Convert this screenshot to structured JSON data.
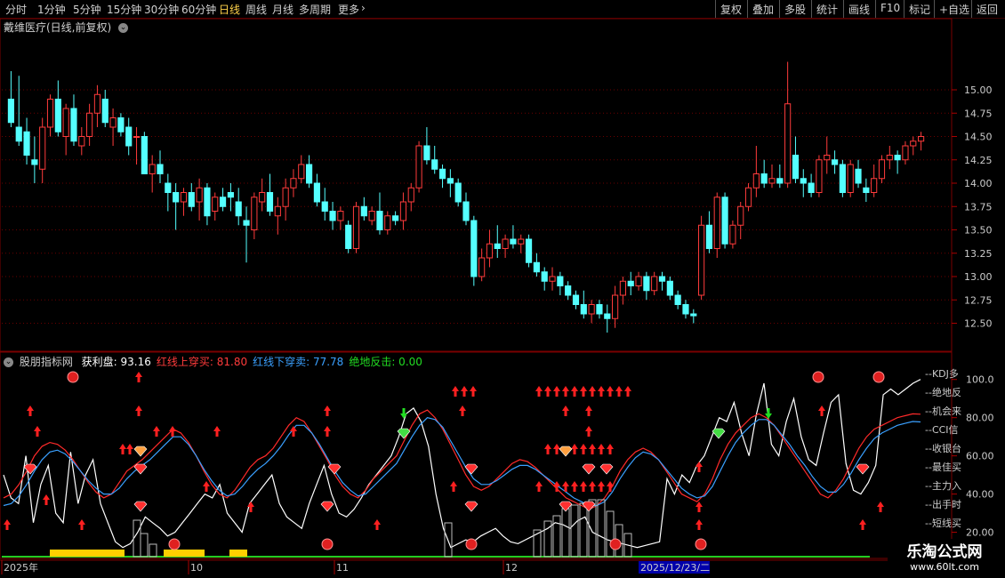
{
  "toolbar": {
    "periods": [
      "分时",
      "1分钟",
      "5分钟",
      "15分钟",
      "30分钟",
      "60分钟",
      "日线",
      "周线",
      "月线",
      "多周期",
      "更多"
    ],
    "active_period": "日线",
    "more_icon": "chevron-right-icon",
    "right_buttons": [
      "复权",
      "叠加",
      "多股",
      "统计",
      "画线",
      "F10",
      "标记",
      "+自选",
      "返回"
    ]
  },
  "main_chart": {
    "title": "戴维医疗(日线,前复权)",
    "dropdown_icon": "chevron-down-icon",
    "price_ticks": [
      "15.00",
      "14.75",
      "14.50",
      "14.25",
      "14.00",
      "13.75",
      "13.50",
      "13.25",
      "13.00",
      "12.75",
      "12.50"
    ],
    "up_color": "#ff3b3b",
    "down_color": "#54ffff"
  },
  "indicator": {
    "name": "股朋指标网",
    "items": [
      {
        "label": "获利盘: 93.16",
        "color": "#ffffff"
      },
      {
        "label": "红线上穿买: 81.80",
        "color": "#ff3b3b"
      },
      {
        "label": "红线下穿卖: 77.78",
        "color": "#3aa0ff"
      },
      {
        "label": "绝地反击: 0.00",
        "color": "#22dd22"
      }
    ],
    "ticks": [
      "100.0",
      "80.00",
      "60.00",
      "40.00",
      "20.00"
    ],
    "legend": [
      "KDJ多",
      "绝地反",
      "机会来",
      "CCI信",
      "收银台",
      "最佳买",
      "主力入",
      "出手时",
      "短线买"
    ]
  },
  "x_axis": {
    "labels": [
      "2025年",
      "10",
      "11",
      "12"
    ],
    "cursor_date": "2025/12/23/二"
  },
  "watermark": {
    "name": "乐淘公式网",
    "url": "www.60lt.com"
  },
  "chart_data": {
    "type": "candlestick",
    "ylim": [
      12.2,
      15.6
    ],
    "candles": [
      [
        14.9,
        15.2,
        14.6,
        14.65
      ],
      [
        14.6,
        15.15,
        14.4,
        14.45
      ],
      [
        14.55,
        14.7,
        14.2,
        14.3
      ],
      [
        14.25,
        14.5,
        14.0,
        14.2
      ],
      [
        14.15,
        14.7,
        14.0,
        14.6
      ],
      [
        14.6,
        14.95,
        14.5,
        14.9
      ],
      [
        14.9,
        15.1,
        14.5,
        14.55
      ],
      [
        14.5,
        14.85,
        14.3,
        14.8
      ],
      [
        14.8,
        14.95,
        14.4,
        14.45
      ],
      [
        14.4,
        14.6,
        14.3,
        14.5
      ],
      [
        14.5,
        14.85,
        14.4,
        14.75
      ],
      [
        14.75,
        15.05,
        14.6,
        14.95
      ],
      [
        14.9,
        15.0,
        14.6,
        14.65
      ],
      [
        14.6,
        14.8,
        14.4,
        14.7
      ],
      [
        14.7,
        14.75,
        14.5,
        14.55
      ],
      [
        14.6,
        14.7,
        14.3,
        14.4
      ],
      [
        14.5,
        14.6,
        14.2,
        14.5
      ],
      [
        14.5,
        14.55,
        14.1,
        14.1
      ],
      [
        14.1,
        14.3,
        13.9,
        14.2
      ],
      [
        14.2,
        14.35,
        14.0,
        14.1
      ],
      [
        14.0,
        14.1,
        13.7,
        13.9
      ],
      [
        13.9,
        14.0,
        13.5,
        13.8
      ],
      [
        13.8,
        13.95,
        13.65,
        13.9
      ],
      [
        13.9,
        14.0,
        13.7,
        13.75
      ],
      [
        13.8,
        14.05,
        13.6,
        13.95
      ],
      [
        13.95,
        14.0,
        13.55,
        13.65
      ],
      [
        13.7,
        13.9,
        13.6,
        13.85
      ],
      [
        13.85,
        13.95,
        13.7,
        13.75
      ],
      [
        13.9,
        14.0,
        13.7,
        13.85
      ],
      [
        13.8,
        13.95,
        13.55,
        13.65
      ],
      [
        13.6,
        13.75,
        13.15,
        13.55
      ],
      [
        13.5,
        13.9,
        13.4,
        13.85
      ],
      [
        13.8,
        14.05,
        13.7,
        13.9
      ],
      [
        13.9,
        14.1,
        13.65,
        13.7
      ],
      [
        13.65,
        13.85,
        13.45,
        13.75
      ],
      [
        13.75,
        14.05,
        13.6,
        13.95
      ],
      [
        13.95,
        14.15,
        13.85,
        14.05
      ],
      [
        14.05,
        14.3,
        14.0,
        14.2
      ],
      [
        14.2,
        14.3,
        13.95,
        14.0
      ],
      [
        14.0,
        14.1,
        13.75,
        13.8
      ],
      [
        13.8,
        13.95,
        13.6,
        13.7
      ],
      [
        13.7,
        13.8,
        13.5,
        13.6
      ],
      [
        13.6,
        13.75,
        13.5,
        13.7
      ],
      [
        13.55,
        13.6,
        13.25,
        13.3
      ],
      [
        13.3,
        13.8,
        13.25,
        13.75
      ],
      [
        13.75,
        13.85,
        13.6,
        13.65
      ],
      [
        13.6,
        13.75,
        13.55,
        13.7
      ],
      [
        13.7,
        13.9,
        13.45,
        13.5
      ],
      [
        13.5,
        13.7,
        13.45,
        13.65
      ],
      [
        13.65,
        13.7,
        13.55,
        13.6
      ],
      [
        13.6,
        13.9,
        13.5,
        13.8
      ],
      [
        13.8,
        14.0,
        13.7,
        13.95
      ],
      [
        13.95,
        14.45,
        13.9,
        14.4
      ],
      [
        14.4,
        14.6,
        14.2,
        14.25
      ],
      [
        14.25,
        14.4,
        14.1,
        14.15
      ],
      [
        14.15,
        14.2,
        13.95,
        14.05
      ],
      [
        14.05,
        14.15,
        13.85,
        14.0
      ],
      [
        14.0,
        14.05,
        13.75,
        13.8
      ],
      [
        13.8,
        13.9,
        13.55,
        13.6
      ],
      [
        13.6,
        13.65,
        12.9,
        13.0
      ],
      [
        13.0,
        13.3,
        12.95,
        13.2
      ],
      [
        13.2,
        13.5,
        13.1,
        13.35
      ],
      [
        13.35,
        13.55,
        13.2,
        13.3
      ],
      [
        13.3,
        13.45,
        13.2,
        13.4
      ],
      [
        13.4,
        13.55,
        13.3,
        13.35
      ],
      [
        13.35,
        13.45,
        13.25,
        13.4
      ],
      [
        13.4,
        13.45,
        13.1,
        13.15
      ],
      [
        13.15,
        13.25,
        13.0,
        13.05
      ],
      [
        13.05,
        13.1,
        12.85,
        12.95
      ],
      [
        12.95,
        13.1,
        12.85,
        13.0
      ],
      [
        13.0,
        13.05,
        12.8,
        12.9
      ],
      [
        12.9,
        12.95,
        12.75,
        12.8
      ],
      [
        12.8,
        12.85,
        12.65,
        12.7
      ],
      [
        12.7,
        12.85,
        12.55,
        12.6
      ],
      [
        12.6,
        12.75,
        12.5,
        12.7
      ],
      [
        12.7,
        12.75,
        12.55,
        12.6
      ],
      [
        12.6,
        12.7,
        12.4,
        12.55
      ],
      [
        12.55,
        12.9,
        12.45,
        12.8
      ],
      [
        12.8,
        13.0,
        12.7,
        12.95
      ],
      [
        12.95,
        13.05,
        12.8,
        12.9
      ],
      [
        12.9,
        13.05,
        12.85,
        13.0
      ],
      [
        13.0,
        13.05,
        12.75,
        12.85
      ],
      [
        12.85,
        13.05,
        12.8,
        13.0
      ],
      [
        13.0,
        13.05,
        12.85,
        12.95
      ],
      [
        12.95,
        13.0,
        12.75,
        12.8
      ],
      [
        12.8,
        12.85,
        12.65,
        12.7
      ],
      [
        12.7,
        12.75,
        12.55,
        12.6
      ],
      [
        12.6,
        12.65,
        12.5,
        12.58
      ],
      [
        12.8,
        13.65,
        12.75,
        13.55
      ],
      [
        13.55,
        13.7,
        13.25,
        13.3
      ],
      [
        13.3,
        13.9,
        13.2,
        13.85
      ],
      [
        13.85,
        13.9,
        13.3,
        13.35
      ],
      [
        13.35,
        13.6,
        13.3,
        13.55
      ],
      [
        13.55,
        13.8,
        13.4,
        13.75
      ],
      [
        13.75,
        14.0,
        13.7,
        13.95
      ],
      [
        13.95,
        14.4,
        13.85,
        14.1
      ],
      [
        14.1,
        14.25,
        13.95,
        14.0
      ],
      [
        14.0,
        14.2,
        13.95,
        14.05
      ],
      [
        14.05,
        14.2,
        13.95,
        14.0
      ],
      [
        14.0,
        15.3,
        13.95,
        14.85
      ],
      [
        14.3,
        14.5,
        14.0,
        14.05
      ],
      [
        14.05,
        14.15,
        13.85,
        14.0
      ],
      [
        14.0,
        14.1,
        13.85,
        13.9
      ],
      [
        13.9,
        14.3,
        13.85,
        14.25
      ],
      [
        14.25,
        14.5,
        14.1,
        14.3
      ],
      [
        14.25,
        14.35,
        14.1,
        14.2
      ],
      [
        14.2,
        14.25,
        13.85,
        13.9
      ],
      [
        13.9,
        14.25,
        13.85,
        14.2
      ],
      [
        14.15,
        14.25,
        13.95,
        14.0
      ],
      [
        13.95,
        14.05,
        13.8,
        13.9
      ],
      [
        13.9,
        14.2,
        13.85,
        14.05
      ],
      [
        14.05,
        14.3,
        14.0,
        14.25
      ],
      [
        14.25,
        14.4,
        14.15,
        14.3
      ],
      [
        14.3,
        14.35,
        14.1,
        14.25
      ],
      [
        14.25,
        14.45,
        14.2,
        14.4
      ],
      [
        14.4,
        14.5,
        14.3,
        14.45
      ],
      [
        14.45,
        14.55,
        14.35,
        14.5
      ]
    ],
    "indicator_ylim": [
      10,
      105
    ],
    "profit_line": [
      50,
      38,
      35,
      60,
      25,
      45,
      55,
      30,
      25,
      62,
      35,
      50,
      58,
      35,
      25,
      15,
      12,
      14,
      20,
      28,
      25,
      22,
      18,
      20,
      25,
      30,
      35,
      40,
      38,
      45,
      30,
      25,
      20,
      35,
      40,
      45,
      50,
      35,
      28,
      25,
      22,
      35,
      45,
      55,
      40,
      30,
      28,
      32,
      38,
      45,
      50,
      55,
      60,
      70,
      82,
      85,
      78,
      65,
      40,
      22,
      12,
      14,
      16,
      15,
      18,
      20,
      22,
      18,
      15,
      14,
      16,
      18,
      20,
      22,
      25,
      24,
      22,
      26,
      28,
      20,
      18,
      16,
      15,
      14,
      13,
      12,
      13,
      14,
      15,
      48,
      40,
      50,
      46,
      55,
      60,
      70,
      80,
      78,
      88,
      72,
      60,
      82,
      98,
      66,
      60,
      78,
      90,
      70,
      58,
      55,
      72,
      88,
      92,
      56,
      42,
      40,
      46,
      55,
      92,
      95,
      92,
      95,
      98,
      100
    ],
    "red_line": [
      38,
      40,
      45,
      52,
      60,
      65,
      67,
      66,
      63,
      58,
      52,
      46,
      41,
      38,
      40,
      46,
      52,
      55,
      58,
      62,
      66,
      70,
      74,
      72,
      67,
      60,
      52,
      45,
      40,
      38,
      42,
      48,
      54,
      58,
      60,
      64,
      70,
      76,
      80,
      78,
      72,
      65,
      58,
      50,
      44,
      40,
      38,
      42,
      48,
      52,
      56,
      60,
      68,
      76,
      82,
      84,
      80,
      74,
      66,
      58,
      50,
      44,
      42,
      44,
      48,
      52,
      56,
      58,
      57,
      54,
      50,
      46,
      42,
      38,
      36,
      34,
      32,
      34,
      38,
      44,
      52,
      58,
      62,
      64,
      62,
      58,
      52,
      46,
      40,
      38,
      36,
      40,
      48,
      58,
      66,
      72,
      76,
      80,
      82,
      80,
      76,
      70,
      64,
      58,
      52,
      46,
      40,
      38,
      42,
      48,
      56,
      64,
      70,
      74,
      76,
      78,
      80,
      81,
      82,
      81.8
    ],
    "blue_line": [
      34,
      35,
      39,
      45,
      52,
      58,
      62,
      63,
      61,
      57,
      52,
      47,
      43,
      40,
      40,
      43,
      48,
      52,
      55,
      58,
      62,
      66,
      70,
      70,
      66,
      60,
      53,
      47,
      42,
      39,
      40,
      44,
      49,
      53,
      56,
      60,
      65,
      71,
      76,
      76,
      72,
      66,
      59,
      52,
      46,
      42,
      39,
      40,
      44,
      48,
      52,
      56,
      63,
      70,
      76,
      80,
      79,
      75,
      68,
      61,
      54,
      48,
      45,
      45,
      47,
      50,
      53,
      55,
      55,
      53,
      50,
      47,
      44,
      41,
      38,
      36,
      34,
      34,
      36,
      41,
      48,
      54,
      59,
      62,
      61,
      58,
      53,
      48,
      43,
      40,
      38,
      39,
      44,
      52,
      60,
      67,
      72,
      76,
      79,
      79,
      76,
      71,
      66,
      60,
      55,
      49,
      44,
      41,
      41,
      45,
      51,
      58,
      64,
      69,
      72,
      74,
      76,
      77,
      78,
      77.78
    ],
    "volume_bars": [
      0,
      0,
      0,
      0,
      0,
      0,
      0,
      0,
      0,
      0,
      0,
      0,
      0,
      0,
      0,
      0,
      0,
      0,
      0,
      0,
      0,
      0,
      0,
      0,
      0,
      0,
      0,
      0,
      0,
      0,
      0,
      0,
      0,
      0,
      0,
      0,
      0,
      0,
      0,
      0,
      0,
      0,
      0,
      0,
      0,
      0,
      0,
      0,
      0,
      0,
      0,
      0,
      0,
      0,
      0,
      0,
      0,
      0,
      0,
      0,
      0,
      0,
      0,
      0,
      0,
      0,
      0,
      0,
      0,
      0,
      0,
      0,
      0,
      0,
      0,
      0,
      0,
      0,
      0,
      0,
      0,
      0,
      0,
      0,
      0,
      0,
      0,
      0,
      0,
      0,
      0,
      0,
      0,
      0,
      0,
      0,
      0,
      0,
      0,
      0,
      0,
      0,
      0,
      0,
      0,
      0,
      0,
      0,
      0,
      0,
      0,
      0,
      0,
      0,
      0,
      0,
      0,
      0,
      0,
      0
    ]
  }
}
